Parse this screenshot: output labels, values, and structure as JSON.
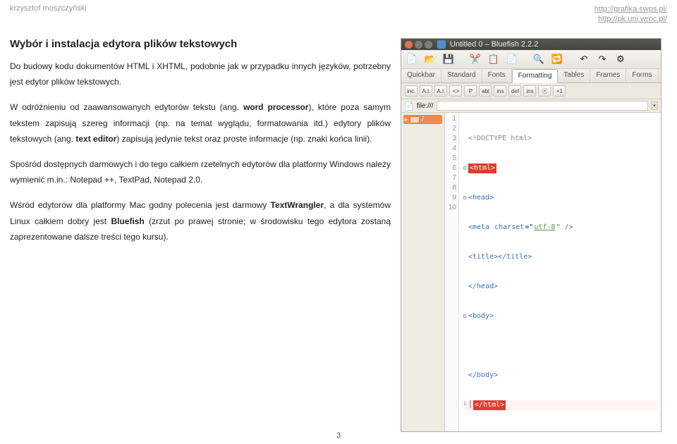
{
  "header": {
    "author": "krzysztof moszczyński",
    "link1": "http://grafika.swps.pl/",
    "link2": "http://pk.uni.wroc.pl/"
  },
  "article": {
    "title": "Wybór i instalacja edytora plików tekstowych",
    "p1": "Do budowy kodu dokumentów HTML i XHTML, podobnie jak w przypadku innych języków, potrzebny jest edytor plików tekstowych.",
    "p2": "W odróżnieniu od zaawansowanych edytorów tekstu (ang. word processor), które poza samym tekstem zapisują szereg informacji (np. na temat wyglądu, formatowania itd.) edytory plików tekstowych (ang. text editor) zapisują jedynie tekst oraz proste informacje (np. znaki końca linii).",
    "p3": "Spośród dostępnych darmowych i do tego całkiem rzetelnych edytorów dla platformy Windows należy wymienić m.in.: Notepad ++, TextPad, Notepad 2.0.",
    "p4": "Wśród edytorów dla platformy Mac godny polecenia jest darmowy TextWrangler, a dla systemów Linux całkiem dobry jest Bluefish (zrzut po prawej stronie; w środowisku tego edytora zostaną zaprezentowane dalsze treści tego kursu)."
  },
  "editor": {
    "window_title": "Untitled 0 – Bluefish 2.2.2",
    "tabs": [
      "Quickbar",
      "Standard",
      "Fonts",
      "Formatting",
      "Tables",
      "Frames",
      "Forms"
    ],
    "active_tab": 3,
    "fmt_buttons": [
      "inc.",
      "A.I.",
      "A.I.",
      "<>",
      "P",
      "abl",
      "ins",
      "def",
      "ins",
      "ⓔ",
      "×1"
    ],
    "filebar_label": "file:///",
    "sidepanel_root": "/",
    "gutter": [
      "1",
      "2",
      "3",
      "4",
      "5",
      "6",
      "7",
      "8",
      "9",
      "10"
    ],
    "code": {
      "l1": "<!DOCTYPE html>",
      "l2": "<html>",
      "l3": "<head>",
      "l4a": "<meta ",
      "l4attr": "charset",
      "l4eq": "=\"",
      "l4val": "utf-8",
      "l4end": "\" />",
      "l5": "<title></title>",
      "l6": "</head>",
      "l7": "<body>",
      "l8": "",
      "l9": "</body>",
      "l10": "</html>"
    }
  },
  "page_number": "3"
}
